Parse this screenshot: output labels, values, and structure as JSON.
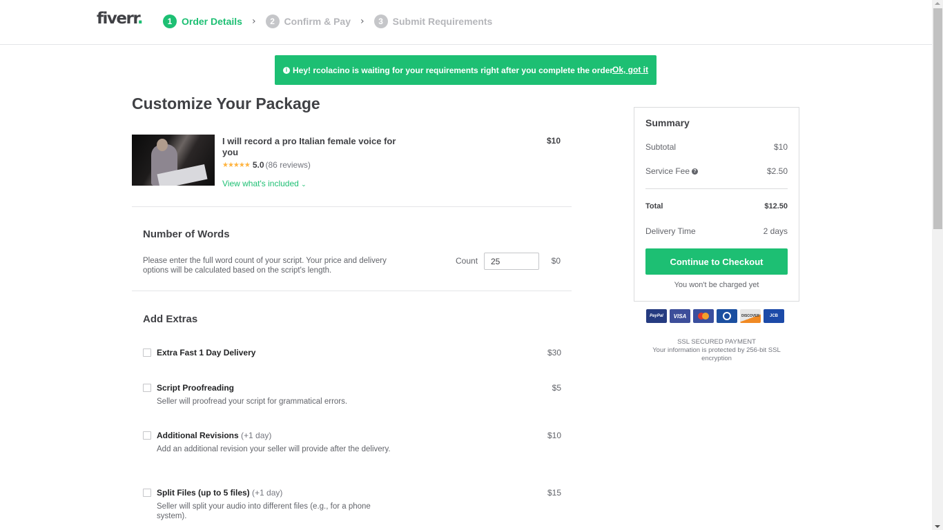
{
  "header": {
    "logo_text": "fiverr",
    "logo_dot": ".",
    "steps": [
      {
        "num": "1",
        "label": "Order Details",
        "active": true
      },
      {
        "num": "2",
        "label": "Confirm & Pay",
        "active": false
      },
      {
        "num": "3",
        "label": "Submit Requirements",
        "active": false
      }
    ],
    "separator_glyph": "›"
  },
  "banner": {
    "icon": "info-icon",
    "icon_glyph": "i",
    "message": "Hey! rcolacino is waiting for your requirements right after you complete the order",
    "dismiss_label": "Ok, got it",
    "color": "#1dbf73"
  },
  "main": {
    "title": "Customize Your Package",
    "gig": {
      "title": "I will record a pro Italian female voice for you",
      "stars": "★★★★★",
      "rating": "5.0",
      "reviews": "(86 reviews)",
      "view_included": "View what's included",
      "view_included_icon": "⌄",
      "price": "$10"
    },
    "words": {
      "title": "Number of Words",
      "description": "Please enter the full word count of your script. Your price and delivery options will be calculated based on the script's length.",
      "count_label": "Count",
      "count_value": "25",
      "price": "$0"
    },
    "extras": {
      "title": "Add Extras",
      "items": [
        {
          "name": "Extra Fast 1 Day Delivery",
          "days": "",
          "description": "",
          "price": "$30",
          "checked": false
        },
        {
          "name": "Script Proofreading",
          "days": "",
          "description": "Seller will proofread your script for grammatical errors.",
          "price": "$5",
          "checked": false
        },
        {
          "name": "Additional Revisions",
          "days": "(+1 day)",
          "description": "Add an additional revision your seller will provide after the delivery.",
          "price": "$10",
          "checked": false
        },
        {
          "name": "Split Files (up to 5 files)",
          "days": "(+1 day)",
          "description": "Seller will split your audio into different files (e.g., for a phone system).",
          "price": "$15",
          "checked": false
        }
      ]
    }
  },
  "summary": {
    "title": "Summary",
    "subtotal_label": "Subtotal",
    "subtotal_value": "$10",
    "service_fee_label": "Service Fee",
    "service_fee_help": "?",
    "service_fee_value": "$2.50",
    "total_label": "Total",
    "total_value": "$12.50",
    "delivery_label": "Delivery Time",
    "delivery_value": "2 days",
    "checkout_label": "Continue to Checkout",
    "not_charged": "You won't be charged yet"
  },
  "payments": {
    "methods": [
      {
        "name": "paypal-icon",
        "label": "PayPal"
      },
      {
        "name": "visa-icon",
        "label": "VISA"
      },
      {
        "name": "mastercard-icon",
        "label": ""
      },
      {
        "name": "diners-club-icon",
        "label": ""
      },
      {
        "name": "discover-icon",
        "label": "DISCOVER"
      },
      {
        "name": "jcb-icon",
        "label": "JCB"
      }
    ],
    "ssl_title": "SSL SECURED PAYMENT",
    "ssl_text": "Your information is protected by 256-bit SSL encryption"
  },
  "scrollbar": {
    "position_fraction": 0.0
  }
}
